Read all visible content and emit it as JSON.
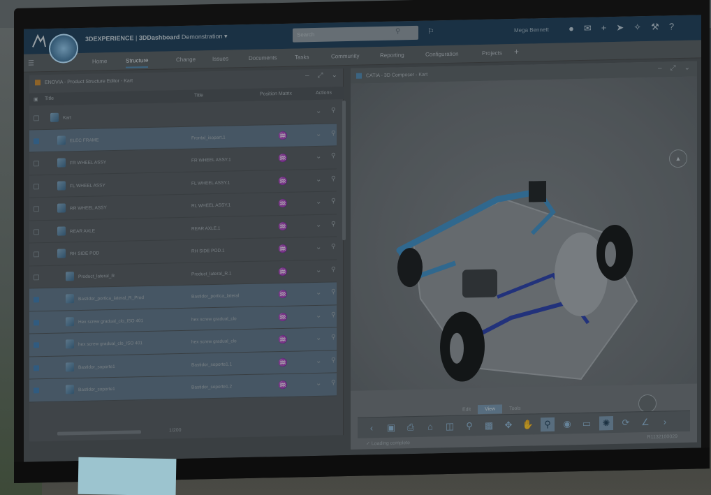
{
  "app": {
    "title_brand": "3DEXPERIENCE",
    "title_app": "3DDashboard",
    "title_context": "Demonstration",
    "search_placeholder": "Search",
    "user_name": "Mega Bennett"
  },
  "tabs": [
    {
      "label": "Home"
    },
    {
      "label": "Structure"
    },
    {
      "label": "Change"
    },
    {
      "label": "Issues"
    },
    {
      "label": "Documents"
    },
    {
      "label": "Tasks"
    },
    {
      "label": "Community"
    },
    {
      "label": "Reporting"
    },
    {
      "label": "Configuration"
    },
    {
      "label": "Projects"
    }
  ],
  "left_panel": {
    "title": "ENOVIA - Product Structure Editor - Kart",
    "columns": {
      "title": "Title",
      "instance": "Title",
      "position": "Position Matrix",
      "actions": "Actions"
    },
    "rows": [
      {
        "name": "Kart",
        "instance": "",
        "selected": false
      },
      {
        "name": "ELEC FRAME",
        "instance": "Frontal_isopart.1",
        "selected": true
      },
      {
        "name": "FR WHEEL ASSY",
        "instance": "FR WHEEL ASSY.1",
        "selected": false
      },
      {
        "name": "FL WHEEL ASSY",
        "instance": "FL WHEEL ASSY.1",
        "selected": false
      },
      {
        "name": "RR WHEEL ASSY",
        "instance": "RL WHEEL ASSY.1",
        "selected": false
      },
      {
        "name": "REAR AXLE",
        "instance": "REAR AXLE.1",
        "selected": false
      },
      {
        "name": "RH SIDE POD",
        "instance": "RH SIDE POD.1",
        "selected": false
      },
      {
        "name": "Product_lateral_R",
        "instance": "Product_lateral_R.1",
        "selected": false
      },
      {
        "name": "Bastidor_portica_lateral_R_Prod",
        "instance": "Bastidor_portica_lateral",
        "selected": true
      },
      {
        "name": "Hex screw gradual_clo_ISO 401",
        "instance": "hex screw gradual_clo",
        "selected": true
      },
      {
        "name": "hex screw gradual_clo_ISO 401",
        "instance": "hex screw gradual_clo",
        "selected": true
      },
      {
        "name": "Bastidor_soporte1",
        "instance": "Bastidor_soporte1.1",
        "selected": true
      },
      {
        "name": "Bastidor_soporte1",
        "instance": "Bastidor_soporte1.2",
        "selected": true
      }
    ],
    "zoom": "1/200"
  },
  "right_panel": {
    "title": "CATIA - 3D Composer - Kart",
    "view_tabs": [
      "Edit",
      "View",
      "Tools"
    ],
    "active_view_tab": "View",
    "status_text": "Loading complete",
    "version": "R1132100029"
  },
  "colors": {
    "topbar": "#1e3d57",
    "accent": "#4f88b1",
    "selection": "#5f7486"
  }
}
